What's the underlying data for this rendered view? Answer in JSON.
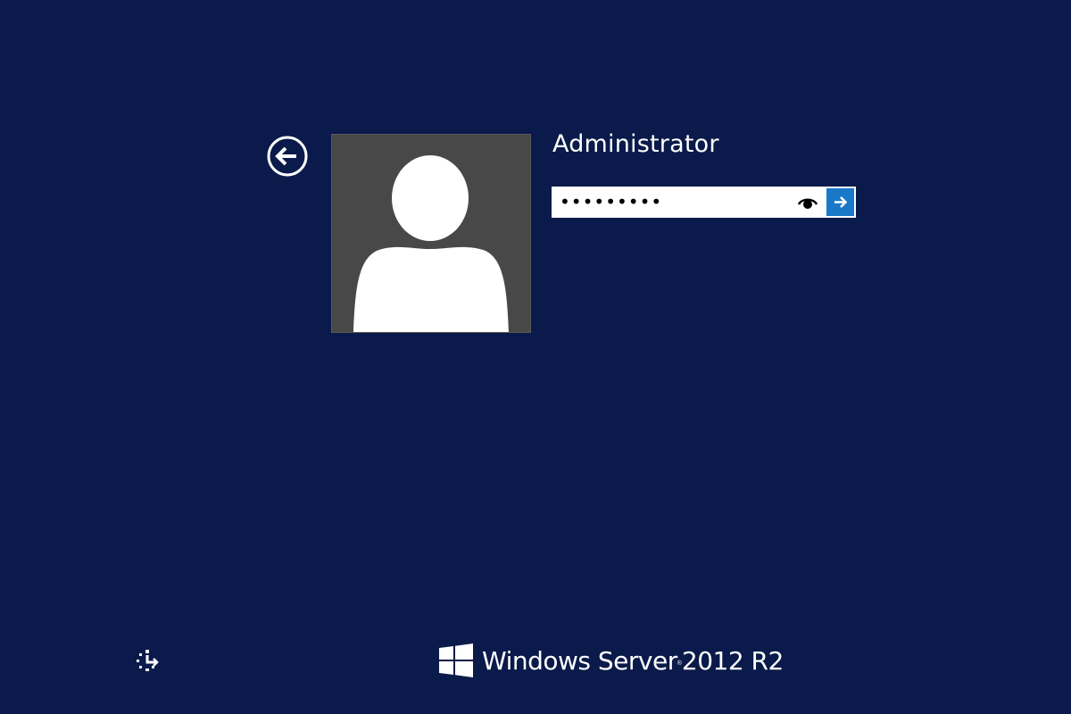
{
  "login": {
    "username": "Administrator",
    "password_masked": "•••••••••"
  },
  "branding": {
    "product_name": "Windows Server",
    "trademark": "®",
    "version": "2012 R2"
  },
  "icons": {
    "back": "back-arrow-circle-icon",
    "avatar": "default-user-icon",
    "reveal": "eye-icon",
    "submit": "right-arrow-icon",
    "ease_of_access": "ease-of-access-icon",
    "logo": "windows-logo-icon"
  },
  "colors": {
    "background": "#0a1a4a",
    "avatar_bg": "#484848",
    "submit_button": "#1a78c8",
    "text": "#ffffff"
  }
}
